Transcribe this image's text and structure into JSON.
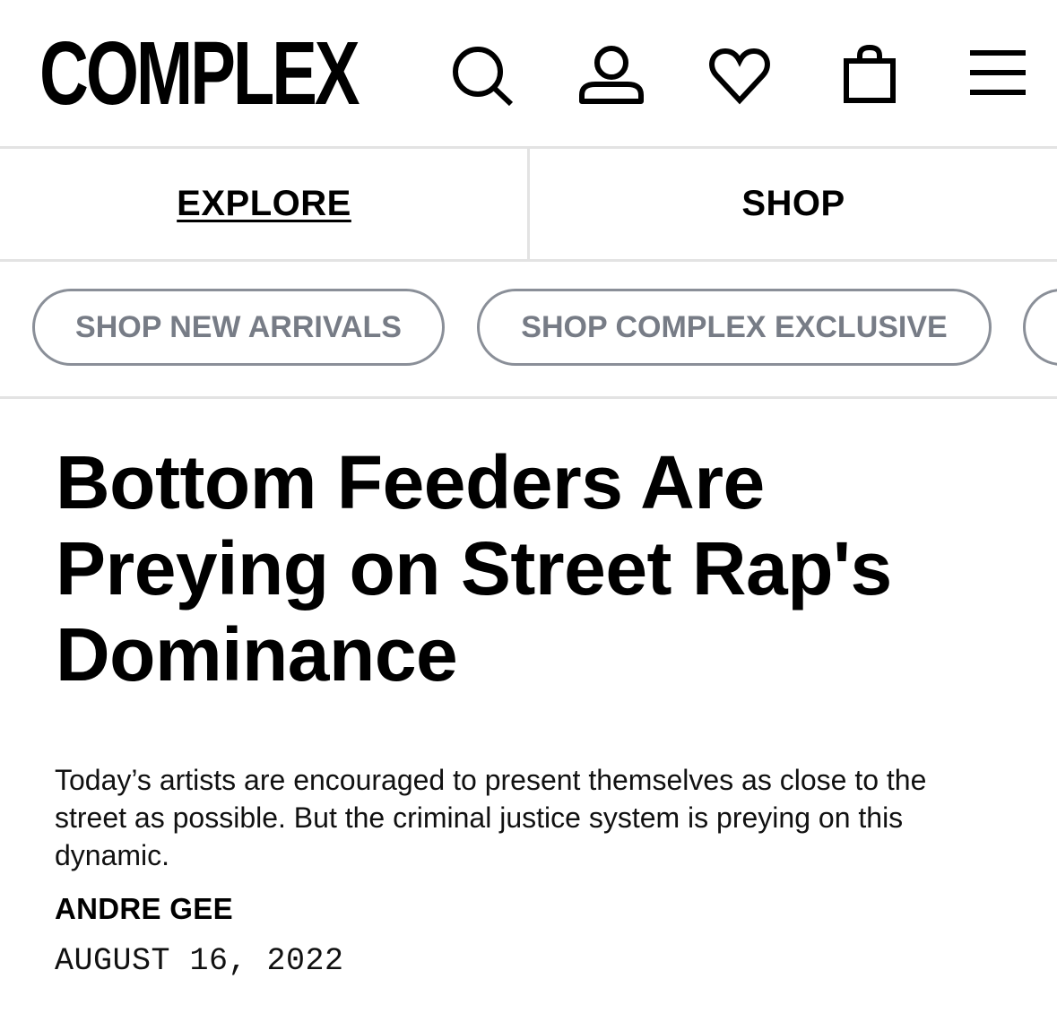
{
  "header": {
    "logo": "COMPLEX",
    "icons": [
      "search-icon",
      "account-icon",
      "heart-icon",
      "shopping-bag-icon",
      "menu-icon"
    ]
  },
  "tabs": [
    {
      "label": "EXPLORE",
      "active": true
    },
    {
      "label": "SHOP",
      "active": false
    }
  ],
  "pills": [
    {
      "label": "SHOP NEW ARRIVALS"
    },
    {
      "label": "SHOP COMPLEX EXCLUSIVE"
    },
    {
      "label": ""
    }
  ],
  "article": {
    "headline": "Bottom Feeders Are Preying on Street Rap's Dominance",
    "dek": "Today’s artists are encouraged to present themselves as close to the street as possible. But the criminal justice system is preying on this dynamic.",
    "author": "ANDRE GEE",
    "date": "AUGUST 16, 2022"
  },
  "colors": {
    "text": "#000000",
    "divider": "#e3e3e3",
    "pill_border": "#8a8f98",
    "pill_text": "#777c86"
  }
}
